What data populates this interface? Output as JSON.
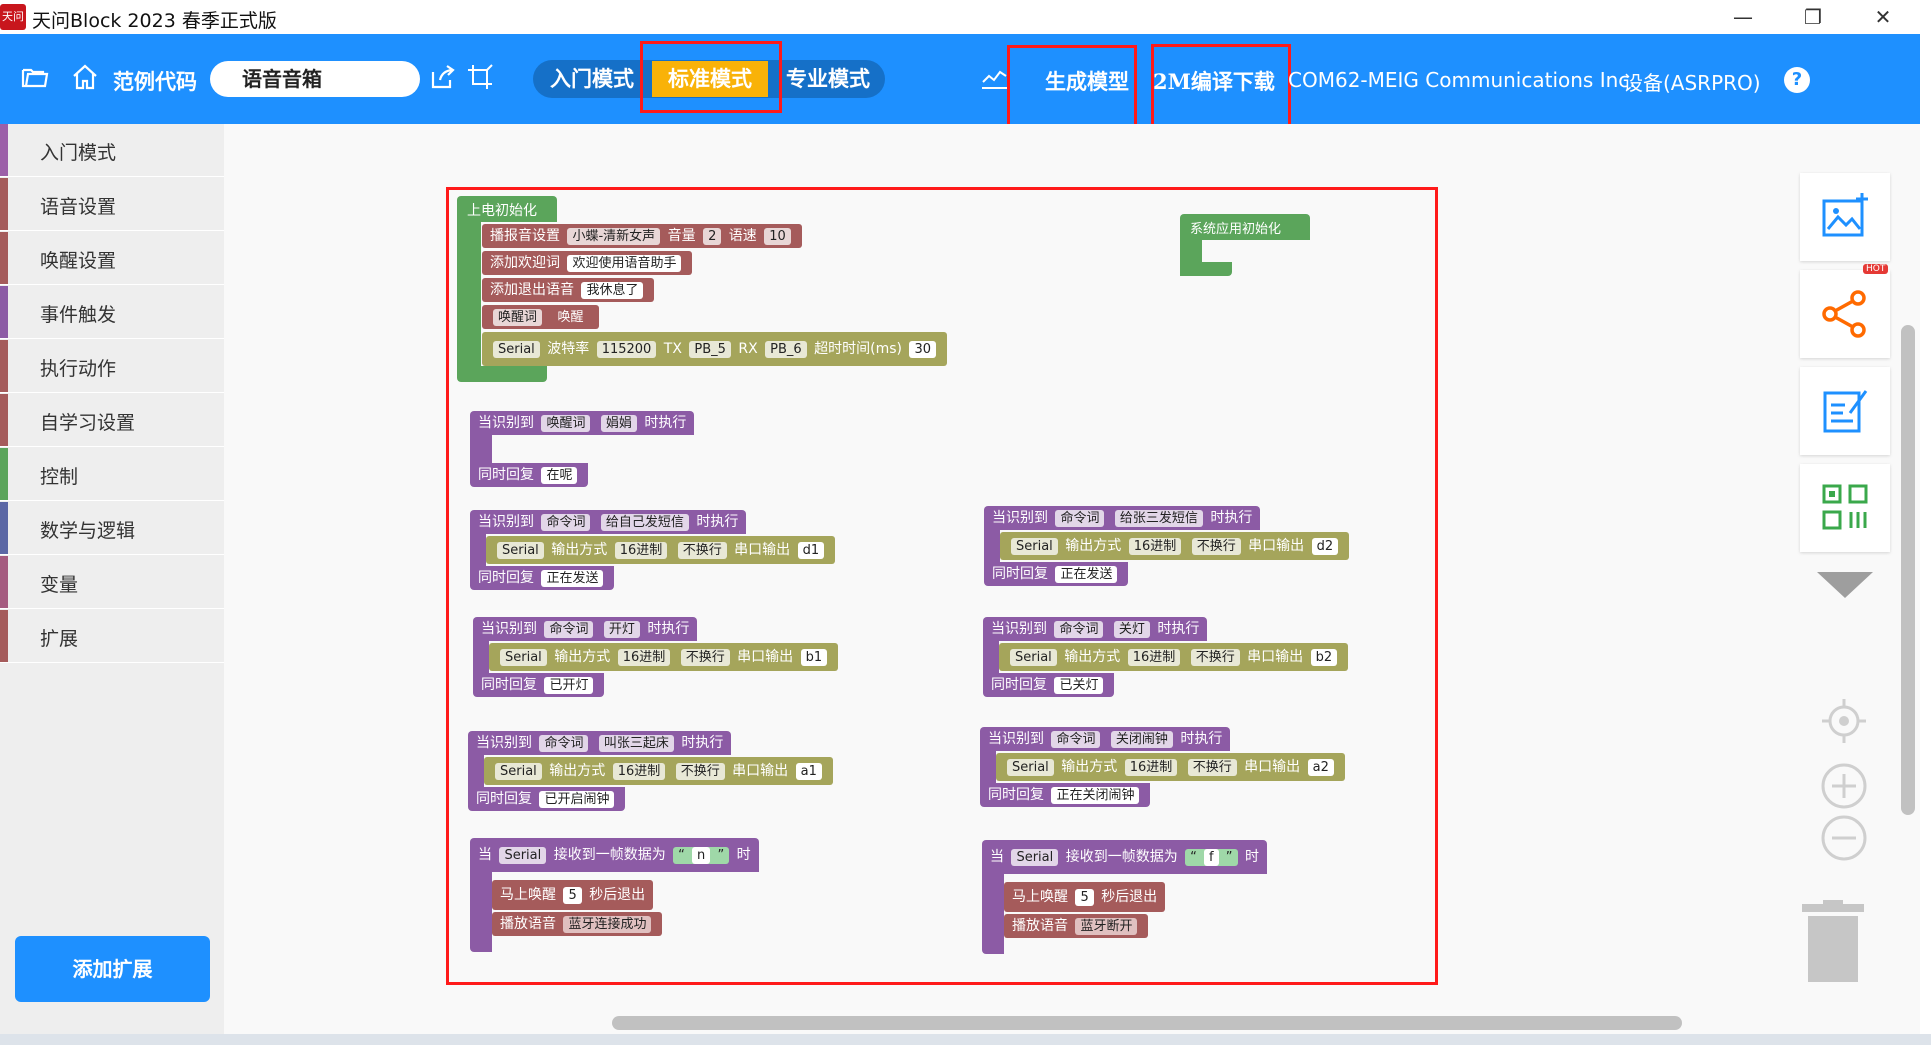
{
  "window": {
    "title": "天问Block 2023 春季正式版",
    "minimize": "—",
    "restore": "❐",
    "close": "✕",
    "icon_text": "天问"
  },
  "toolbar": {
    "examples_label": "范例代码",
    "project_name": "语音音箱",
    "modes": [
      "入门模式",
      "标准模式",
      "专业模式"
    ],
    "active_mode": "标准模式",
    "generate_model": "生成模型",
    "compile_download": "2M编译下载",
    "port": "COM62-MEIG Communications Inc.",
    "device": "设备(ASRPRO)",
    "help": "?"
  },
  "sidebar": {
    "items": [
      {
        "label": "入门模式",
        "color": "#9c5fa8"
      },
      {
        "label": "语音设置",
        "color": "#a55b5b"
      },
      {
        "label": "唤醒设置",
        "color": "#a55b5b"
      },
      {
        "label": "事件触发",
        "color": "#8c5ba5"
      },
      {
        "label": "执行动作",
        "color": "#a55b5b"
      },
      {
        "label": "自学习设置",
        "color": "#a55b5b"
      },
      {
        "label": "控制",
        "color": "#5ba55b"
      },
      {
        "label": "数学与逻辑",
        "color": "#5b67a5"
      },
      {
        "label": "变量",
        "color": "#a55b80"
      },
      {
        "label": "扩展",
        "color": "#a55b5b"
      }
    ],
    "add_extension": "添加扩展"
  },
  "blocks": {
    "init": {
      "header": "上电初始化",
      "broadcast": {
        "label": "播报音设置",
        "voice": "小蝶-清新女声",
        "volume_label": "音量",
        "volume": "2",
        "speed_label": "语速",
        "speed": "10"
      },
      "welcome": {
        "label": "添加欢迎词",
        "text": "欢迎使用语音助手"
      },
      "exit": {
        "label": "添加退出语音",
        "text": "我休息了"
      },
      "wake": {
        "label": "唤醒词",
        "text": "唤醒"
      },
      "serial": {
        "port": "Serial",
        "baud_label": "波特率",
        "baud": "115200",
        "tx_label": "TX",
        "tx": "PB_5",
        "rx_label": "RX",
        "rx": "PB_6",
        "timeout_label": "超时时间(ms)",
        "timeout": "30"
      }
    },
    "sys_init": "系统应用初始化",
    "wake_event": {
      "prefix": "当识别到",
      "type": "唤醒词",
      "word": "娟娟",
      "suffix": "时执行",
      "reply_label": "同时回复",
      "reply": "在呢"
    },
    "commands": [
      {
        "type": "命令词",
        "word": "给自己发短信",
        "output": "d1",
        "reply": "正在发送"
      },
      {
        "type": "命令词",
        "word": "给张三发短信",
        "output": "d2",
        "reply": "正在发送"
      },
      {
        "type": "命令词",
        "word": "开灯",
        "output": "b1",
        "reply": "已开灯"
      },
      {
        "type": "命令词",
        "word": "关灯",
        "output": "b2",
        "reply": "已关灯"
      },
      {
        "type": "命令词",
        "word": "叫张三起床",
        "output": "a1",
        "reply": "已开启闹钟"
      },
      {
        "type": "命令词",
        "word": "关闭闹钟",
        "output": "a2",
        "reply": "正在关闭闹钟"
      }
    ],
    "cmd_labels": {
      "prefix": "当识别到",
      "suffix": "时执行",
      "serial": "Serial",
      "mode_label": "输出方式",
      "mode": "16进制",
      "newline": "不换行",
      "out_label": "串口输出",
      "reply_label": "同时回复"
    },
    "receive": [
      {
        "char": "n",
        "audio": "蓝牙连接成功"
      },
      {
        "char": "f",
        "audio": "蓝牙断开"
      }
    ],
    "recv_labels": {
      "when": "当",
      "serial": "Serial",
      "label": "接收到一帧数据为",
      "open_q": "“",
      "close_q": "”",
      "time": "时",
      "wake": "马上唤醒",
      "seconds": "5",
      "exit": "秒后退出",
      "play": "播放语音"
    }
  },
  "colors": {
    "toolbar": "#1e90ff",
    "active_mode": "#f9b208",
    "highlight": "#ff1a1a",
    "hot": "#e53935"
  },
  "right_panel": {
    "hot_label": "HOT"
  }
}
